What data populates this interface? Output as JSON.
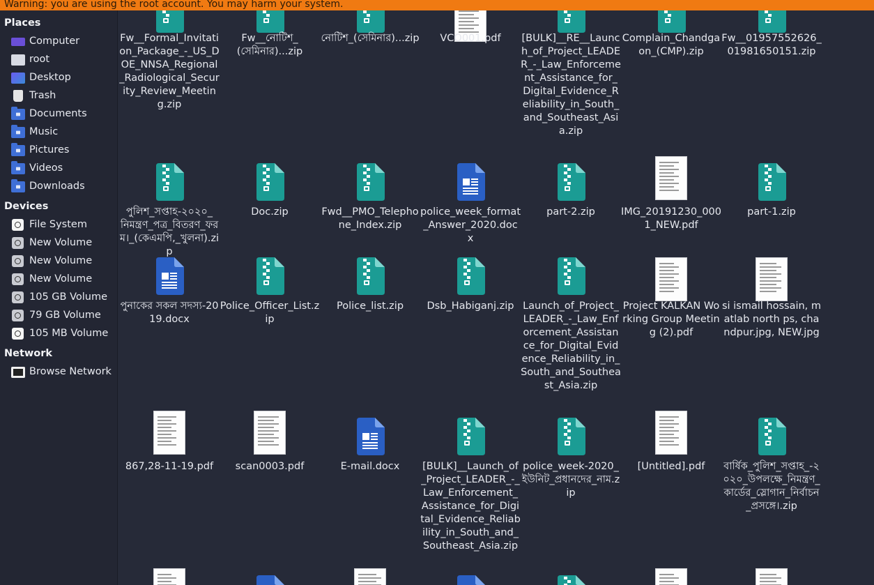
{
  "warning": "Warning: you are using the root account. You may harm your system.",
  "sidebar": {
    "places_title": "Places",
    "places": [
      {
        "label": "Computer",
        "icon": "computer-icon"
      },
      {
        "label": "root",
        "icon": "home-folder-icon"
      },
      {
        "label": "Desktop",
        "icon": "desktop-folder-icon"
      },
      {
        "label": "Trash",
        "icon": "trash-icon"
      },
      {
        "label": "Documents",
        "icon": "documents-folder-icon"
      },
      {
        "label": "Music",
        "icon": "music-folder-icon"
      },
      {
        "label": "Pictures",
        "icon": "pictures-folder-icon"
      },
      {
        "label": "Videos",
        "icon": "videos-folder-icon"
      },
      {
        "label": "Downloads",
        "icon": "downloads-folder-icon"
      }
    ],
    "devices_title": "Devices",
    "devices": [
      {
        "label": "File System"
      },
      {
        "label": "New Volume"
      },
      {
        "label": "New Volume"
      },
      {
        "label": "New Volume"
      },
      {
        "label": "105 GB Volume"
      },
      {
        "label": "79 GB Volume"
      },
      {
        "label": "105 MB Volume"
      }
    ],
    "network_title": "Network",
    "network": [
      {
        "label": "Browse Network",
        "icon": "network-icon"
      }
    ]
  },
  "files": [
    {
      "name": "Fw__Formal_Invitation_Package_-_US_DOE_NNSA_Regional_Radiological_Security_Review_Meeting.zip",
      "type": "zip"
    },
    {
      "name": "Fw__নোটিশ_(সেমিনার)...zip",
      "type": "zip"
    },
    {
      "name": "নোটিশ_(সেমিনার)...zip",
      "type": "zip"
    },
    {
      "name": "VCO001.pdf",
      "type": "pdf"
    },
    {
      "name": "[BULK]__RE__Launch_of_Project_LEADER_-_Law_Enforcement_Assistance_for_Digital_Evidence_Reliability_in_South_and_Southeast_Asia.zip",
      "type": "zip"
    },
    {
      "name": "Complain_Chandgaon_(CMP).zip",
      "type": "zip"
    },
    {
      "name": "Fw__01957552626_01981650151.zip",
      "type": "zip"
    },
    {
      "name": "পুলিশ_সপ্তাহ-২০২০_নিমন্ত্রণ_পত্র_বিতরণ_ফরম।_(কেএমপি,_খুলনা).zip",
      "type": "zip"
    },
    {
      "name": "Doc.zip",
      "type": "zip"
    },
    {
      "name": "Fwd__PMO_Telephone_Index.zip",
      "type": "zip"
    },
    {
      "name": "police_week_format_Answer_2020.docx",
      "type": "docx"
    },
    {
      "name": "part-2.zip",
      "type": "zip"
    },
    {
      "name": "IMG_20191230_0001_NEW.pdf",
      "type": "pdf"
    },
    {
      "name": "part-1.zip",
      "type": "zip"
    },
    {
      "name": "পুনাকের সকল সদস্য-2019.docx",
      "type": "docx"
    },
    {
      "name": "Police_Officer_List.zip",
      "type": "zip"
    },
    {
      "name": "Police_list.zip",
      "type": "zip"
    },
    {
      "name": "Dsb_Habiganj.zip",
      "type": "zip"
    },
    {
      "name": "Launch_of_Project_LEADER_-_Law_Enforcement_Assistance_for_Digital_Evidence_Reliability_in_South_and_Southeast_Asia.zip",
      "type": "zip"
    },
    {
      "name": "Project KALKAN Working Group Meeting (2).pdf",
      "type": "pdf"
    },
    {
      "name": "si ismail hossain, matlab north ps, chandpur.jpg, NEW.jpg",
      "type": "pdf"
    },
    {
      "name": "867,28-11-19.pdf",
      "type": "pdf"
    },
    {
      "name": "scan0003.pdf",
      "type": "pdf"
    },
    {
      "name": "E-mail.docx",
      "type": "docx"
    },
    {
      "name": "[BULK]__Launch_of_Project_LEADER_-_Law_Enforcement_Assistance_for_Digital_Evidence_Reliability_in_South_and_Southeast_Asia.zip",
      "type": "zip"
    },
    {
      "name": "police_week-2020_ইউনিট_প্রধানদের_নাম.zip",
      "type": "zip"
    },
    {
      "name": "[Untitled].pdf",
      "type": "pdf"
    },
    {
      "name": "বার্ষিক_পুলিশ_সপ্তাহ_-২০২০_উপলক্ষে_নিমন্ত্রণ_কার্ডের_স্লোগান_নির্বাচন_প্রসঙ্গে।.zip",
      "type": "zip"
    },
    {
      "name": "",
      "type": "pdf"
    },
    {
      "name": "",
      "type": "docx"
    },
    {
      "name": "",
      "type": "pdf"
    },
    {
      "name": "",
      "type": "docx"
    },
    {
      "name": "",
      "type": "zip"
    },
    {
      "name": "",
      "type": "pdf"
    },
    {
      "name": "",
      "type": "pdf"
    }
  ],
  "colors": {
    "zip": "#1b9c94",
    "zip_fold": "#7fd6cf",
    "docx": "#2a5fc4",
    "folder": "#3f6fd6",
    "warning": "#f07a12"
  }
}
